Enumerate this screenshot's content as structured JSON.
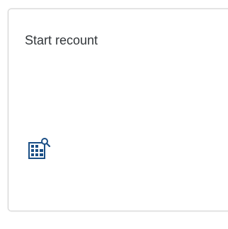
{
  "tile": {
    "title": "Start recount",
    "icon": "inventory-search-icon",
    "accent_color": "#1b4f86"
  }
}
